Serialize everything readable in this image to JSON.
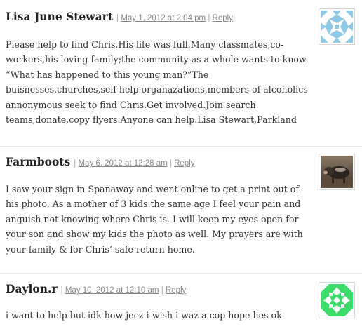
{
  "comments": [
    {
      "author": "Lisa June Stewart",
      "date": "May 1, 2012 at 2:04 pm",
      "reply": "Reply",
      "text": "Please help to find Chris.His life was full.Many classmates,co-workers,his loving family;the community as a whole wants to know “What has happened to this young man?”The buisnesses,churches,self-help organazations,members of alcoholics annonymous seek to find Chris.Get involved.Join search teams,donate,copy flyers.Anyone can help.Lisa Stewart,Parkland",
      "avatar": "identicon-avatar",
      "avatar_color": "#8fc9e6"
    },
    {
      "author": "Farmboots",
      "date": "May 6, 2012 at 12:28 am",
      "reply": "Reply",
      "text": "I saw your sign in Spanaway and went online to get a print out of his photo. As a mother of 3 kids the same age I feel your pain and anguish not knowing where Chris is. I will keep my eyes open for your son and show my kids the photo as well. My prayers are with your family & for Chris’ safe return home.",
      "avatar": "photo-avatar-pig"
    },
    {
      "author": "Daylon.r",
      "date": "May 10, 2012 at 12:10 am",
      "reply": "Reply",
      "text": "i want to help but idk how jeez i wish i waz a cop hope hes ok",
      "avatar": "identicon-avatar",
      "avatar_color": "#3ddc6a"
    }
  ]
}
